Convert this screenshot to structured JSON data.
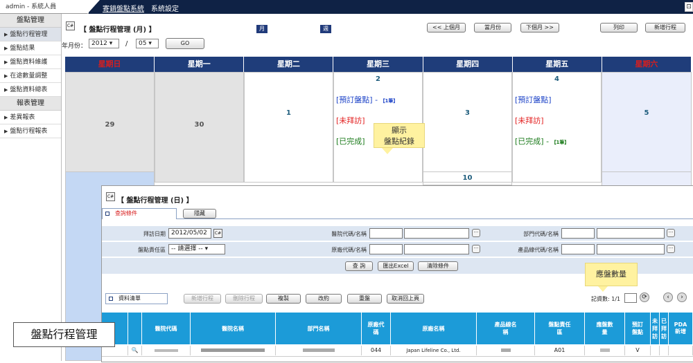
{
  "topbar": {
    "user": "admin - 系統人員",
    "nav_active": "寄銷盤點系統",
    "nav_settings": "系統設定",
    "corner": "⊡"
  },
  "sidebar": {
    "group1": "盤點管理",
    "items1": [
      "盤點行程管理",
      "盤點結果",
      "盤點資料維護",
      "在途數量調整",
      "盤點資料總表"
    ],
    "group2": "報表管理",
    "items2": [
      "差異報表",
      "盤點行程報表"
    ]
  },
  "header": {
    "title": "【 盤點行程管理 (月) 】",
    "mode_month": "月",
    "mode_week": "週",
    "prev": "<< 上個月",
    "current": "當月份",
    "next": "下個月 >>",
    "print": "列印",
    "new_trip": "新增行程",
    "ym_label": "年月份：",
    "year": "2012",
    "slash": "/",
    "month": "05",
    "go": "GO"
  },
  "calendar": {
    "weekdays": [
      "星期日",
      "星期一",
      "星期二",
      "星期三",
      "星期四",
      "星期五",
      "星期六"
    ],
    "days": {
      "d29": "29",
      "d30": "30",
      "d1": "1",
      "d2": "2",
      "d3": "3",
      "d4": "4",
      "d5": "5",
      "d10": "10"
    },
    "wed_events": {
      "e1": "[預訂盤點]",
      "e1_sep": " - ",
      "e1_badge": "【1筆】",
      "e2": "[未拜訪]",
      "e3": "[已完成]"
    },
    "fri_events": {
      "e1": "[預訂盤點]",
      "e2": "[未拜訪]",
      "e3": "[已完成]",
      "e3_sep": " - ",
      "e3_badge": "【1筆】"
    },
    "tooltip": "顯示\n盤點紀錄"
  },
  "day_panel": {
    "title": "【 盤點行程管理 (日) 】",
    "tab_query": "查詢條件",
    "tab_hide": "隱藏",
    "visit_date_label": "拜訪日期",
    "visit_date": "2012/05/02",
    "owner_label": "盤點責任區",
    "owner_value": "-- 請選擇 --",
    "hospital_label": "醫院代碼/名稱",
    "factory_label": "原廠代碼/名稱",
    "dept_label": "部門代碼/名稱",
    "product_label": "產品線代碼/名稱",
    "btn_query": "查 詢",
    "btn_export": "匯出Excel",
    "btn_clear": "清除條件",
    "tooltip": "應盤數量",
    "list_tab": "資料清單",
    "btn_add": "新增行程",
    "btn_delete": "刪除行程",
    "btn_copy": "複製",
    "btn_edit": "改約",
    "btn_recount": "重盤",
    "btn_cancel": "取消回上頁",
    "paging": "記資數: 1/1",
    "columns": [
      "醫院代碼",
      "醫院名稱",
      "部門名稱",
      "原廠代碼",
      "原廠名稱",
      "產品線名稱",
      "盤點責任區",
      "應盤數量",
      "預訂盤點",
      "未拜訪",
      "已拜訪",
      "PDA新增"
    ],
    "row": {
      "factory_code": "044",
      "factory_name": "Japan Lifeline Co., Ltd.",
      "owner": "A01",
      "scheduled": "V"
    }
  },
  "caption": "盤點行程管理",
  "colors": {
    "navy": "#1f3d7a",
    "table_head": "#1c9bd8",
    "weekend": "#d81e1e"
  }
}
